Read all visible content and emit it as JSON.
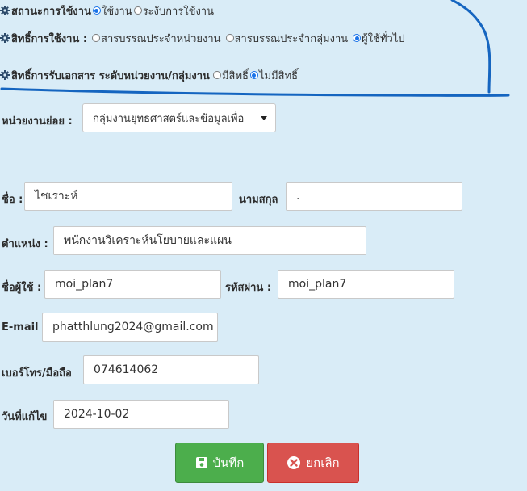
{
  "status": {
    "label": "สถานะการใช้งาน",
    "options": [
      "ใช้งาน",
      "ระงับการใช้งาน"
    ],
    "selected": 0
  },
  "rights": {
    "label": "สิทธิ์การใช้งาน :",
    "options": [
      "สารบรรณประจำหน่วยงาน",
      "สารบรรณประจำกลุ่มงาน",
      "ผู้ใช้ทั่วไป"
    ],
    "selected": 2
  },
  "doc_rights": {
    "label": "สิทธิ์การรับเอกสาร ระดับหน่วยงาน/กลุ่มงาน",
    "options": [
      "มีสิทธิ์",
      "ไม่มีสิทธิ์"
    ],
    "selected": 1
  },
  "subunit": {
    "label": "หน่วยงานย่อย :",
    "value": "กลุ่มงานยุทธศาสตร์และข้อมูลเพื่อ"
  },
  "form": {
    "first_name_label": "ชื่อ :",
    "first_name": "ไชเราะห์",
    "last_name_label": "นามสกุล",
    "last_name": ".",
    "position_label": "ตำแหน่ง :",
    "position": "พนักงานวิเคราะห์นโยบายและแผน",
    "username_label": "ชื่อผู้ใช้ :",
    "username": "moi_plan7",
    "password_label": "รหัสผ่าน :",
    "password": "moi_plan7",
    "email_label": "E-mail",
    "email": "phatthlung2024@gmail.com",
    "phone_label": "เบอร์โทร/มือถือ",
    "phone": "074614062",
    "date_label": "วันที่แก้ไข",
    "date": "2024-10-02"
  },
  "buttons": {
    "save": "บันทึก",
    "cancel": "ยกเลิก"
  },
  "colors": {
    "annotation": "#1565c0",
    "save": "#4cae4c",
    "cancel": "#d9534f",
    "background": "#d9ecf7"
  }
}
